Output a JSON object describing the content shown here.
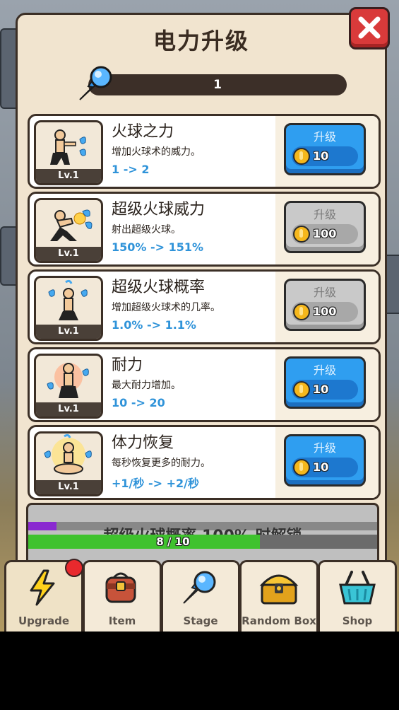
{
  "header": {
    "title": "电力升级",
    "energy_value": "1"
  },
  "upgrades": [
    {
      "title": "火球之力",
      "desc": "增加火球术的威力。",
      "change": "1 -> 2",
      "level": "Lv.1",
      "button_label": "升级",
      "cost": "10",
      "state": "blue"
    },
    {
      "title": "超级火球威力",
      "desc": "射出超级火球。",
      "change": "150% -> 151%",
      "level": "Lv.1",
      "button_label": "升级",
      "cost": "100",
      "state": "gray"
    },
    {
      "title": "超级火球概率",
      "desc": "增加超级火球术的几率。",
      "change": "1.0% -> 1.1%",
      "level": "Lv.1",
      "button_label": "升级",
      "cost": "100",
      "state": "gray"
    },
    {
      "title": "耐力",
      "desc": "最大耐力增加。",
      "change": "10 -> 20",
      "level": "Lv.1",
      "button_label": "升级",
      "cost": "10",
      "state": "blue"
    },
    {
      "title": "体力恢复",
      "desc": "每秒恢复更多的耐力。",
      "change": "+1/秒 -> +2/秒",
      "level": "Lv.1",
      "button_label": "升级",
      "cost": "10",
      "state": "blue"
    }
  ],
  "unlock": {
    "text": "超级火球概率 100% 时解锁",
    "progress_label": "8 / 10",
    "progress": 0.8,
    "purple_progress": 0.08
  },
  "nav": [
    {
      "label": "Upgrade",
      "icon": "lightning-icon"
    },
    {
      "label": "Item",
      "icon": "backpack-icon"
    },
    {
      "label": "Stage",
      "icon": "fireball-icon"
    },
    {
      "label": "Random Box",
      "icon": "treasure-chest-icon"
    },
    {
      "label": "Shop",
      "icon": "basket-icon"
    }
  ],
  "colors": {
    "blue_button": "#2f9ef0",
    "gray_button": "#c9c9c9",
    "accent_text": "#2f93d9",
    "progress_green": "#3fc22e"
  }
}
